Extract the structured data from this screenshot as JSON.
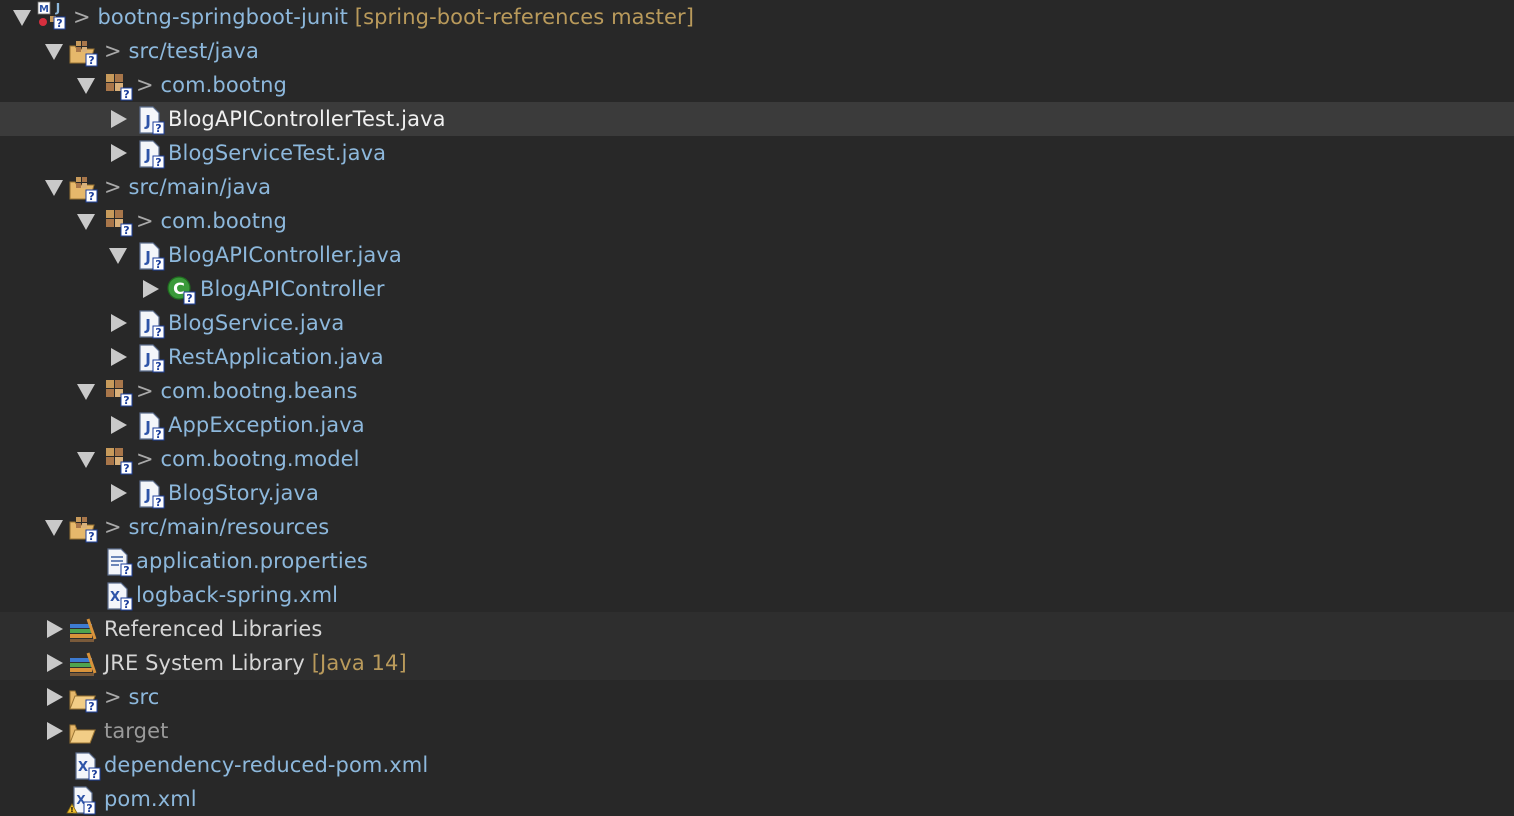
{
  "colors": {
    "background": "#282828",
    "selected_row": "#3b3b3b",
    "library_row": "#2e2e2e",
    "name_blue": "#8db8dc",
    "decoration_gold": "#b99a5b"
  },
  "tree": {
    "project": {
      "prefix": ">",
      "name": "bootng-springboot-junit",
      "decoration": "[spring-boot-references master]"
    },
    "src_test_java": {
      "prefix": ">",
      "name": "src/test/java"
    },
    "pkg_test": {
      "prefix": ">",
      "name": "com.bootng"
    },
    "file_blogapicontrollertest": {
      "name": "BlogAPIControllerTest.java"
    },
    "file_blogservicetest": {
      "name": "BlogServiceTest.java"
    },
    "src_main_java": {
      "prefix": ">",
      "name": "src/main/java"
    },
    "pkg_main": {
      "prefix": ">",
      "name": "com.bootng"
    },
    "file_blogapicontroller": {
      "name": "BlogAPIController.java"
    },
    "class_blogapicontroller": {
      "name": "BlogAPIController"
    },
    "file_blogservice": {
      "name": "BlogService.java"
    },
    "file_restapplication": {
      "name": "RestApplication.java"
    },
    "pkg_beans": {
      "prefix": ">",
      "name": "com.bootng.beans"
    },
    "file_appexception": {
      "name": "AppException.java"
    },
    "pkg_model": {
      "prefix": ">",
      "name": "com.bootng.model"
    },
    "file_blogstory": {
      "name": "BlogStory.java"
    },
    "src_main_resources": {
      "prefix": ">",
      "name": "src/main/resources"
    },
    "file_application_properties": {
      "name": "application.properties"
    },
    "file_logback": {
      "name": "logback-spring.xml"
    },
    "referenced_libraries": {
      "name": "Referenced Libraries"
    },
    "jre_library": {
      "name": "JRE System Library",
      "decoration": "[Java 14]"
    },
    "folder_src": {
      "prefix": ">",
      "name": "src"
    },
    "folder_target": {
      "name": "target"
    },
    "file_dependency_reduced_pom": {
      "name": "dependency-reduced-pom.xml"
    },
    "file_pom": {
      "name": "pom.xml"
    }
  }
}
